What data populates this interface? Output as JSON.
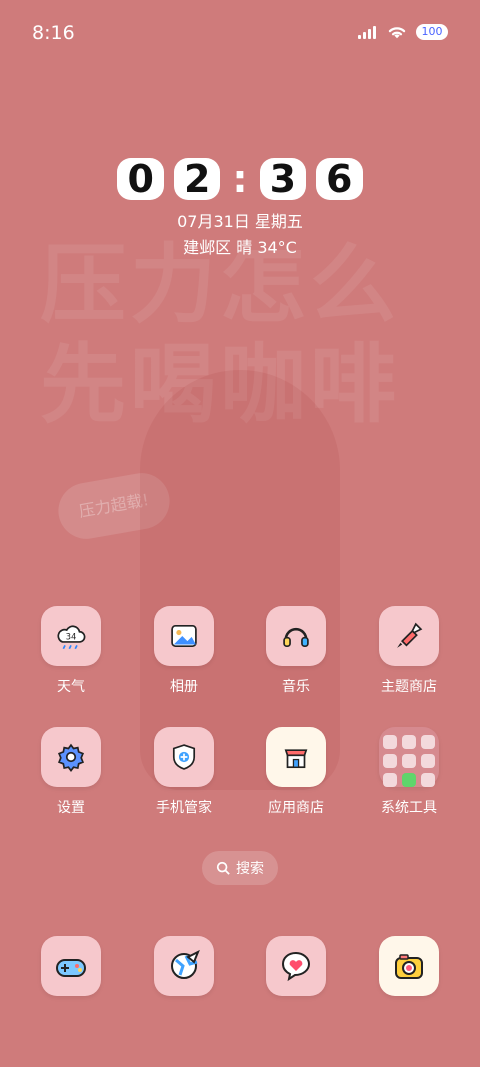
{
  "status_bar": {
    "time": "8:16",
    "battery": "100"
  },
  "lock_widget": {
    "clock": [
      "0",
      "2",
      ":",
      "3",
      "6"
    ],
    "date": "07月31日 星期五",
    "weather": "建邺区 晴 34°C"
  },
  "apps": [
    {
      "label": "天气",
      "icon": "weather-icon"
    },
    {
      "label": "相册",
      "icon": "gallery-icon"
    },
    {
      "label": "音乐",
      "icon": "music-icon"
    },
    {
      "label": "主题商店",
      "icon": "theme-store-icon"
    },
    {
      "label": "设置",
      "icon": "settings-icon"
    },
    {
      "label": "手机管家",
      "icon": "phone-manager-icon"
    },
    {
      "label": "应用商店",
      "icon": "app-store-icon"
    },
    {
      "label": "系统工具",
      "icon": "system-tools-folder-icon"
    }
  ],
  "search": {
    "label": "搜索"
  },
  "dock": [
    {
      "icon": "game-icon"
    },
    {
      "icon": "browser-icon"
    },
    {
      "icon": "messages-icon"
    },
    {
      "icon": "camera-icon"
    }
  ],
  "wallpaper": {
    "text_lines": [
      "压力怎么",
      "先喝咖啡"
    ],
    "bubble_text": "压力超载!"
  }
}
